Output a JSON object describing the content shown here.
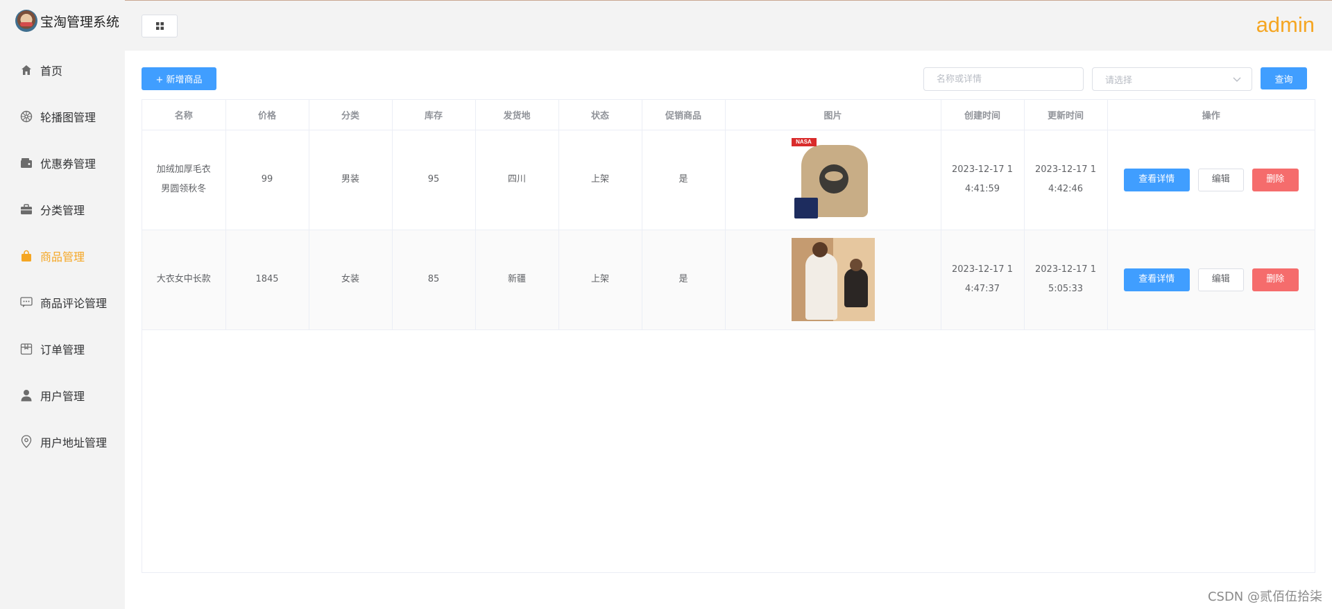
{
  "app": {
    "title": "宝淘管理系统",
    "user": "admin"
  },
  "sidebar": {
    "items": [
      {
        "label": "首页",
        "icon": "home-icon"
      },
      {
        "label": "轮播图管理",
        "icon": "wheel-icon"
      },
      {
        "label": "优惠券管理",
        "icon": "wallet-icon"
      },
      {
        "label": "分类管理",
        "icon": "briefcase-icon"
      },
      {
        "label": "商品管理",
        "icon": "shopping-bag-icon",
        "active": true
      },
      {
        "label": "商品评论管理",
        "icon": "comment-icon"
      },
      {
        "label": "订单管理",
        "icon": "box-icon"
      },
      {
        "label": "用户管理",
        "icon": "user-icon"
      },
      {
        "label": "用户地址管理",
        "icon": "location-icon"
      }
    ]
  },
  "toolbar": {
    "add_label": "+ 新增商品",
    "search_placeholder": "名称或详情",
    "select_placeholder": "请选择",
    "query_label": "查询"
  },
  "table": {
    "headers": [
      "名称",
      "价格",
      "分类",
      "库存",
      "发货地",
      "状态",
      "促销商品",
      "图片",
      "创建时间",
      "更新时间",
      "操作"
    ],
    "rows": [
      {
        "name_line1": "加绒加厚毛衣",
        "name_line2": "男圆领秋冬",
        "price": "99",
        "category": "男装",
        "stock": "95",
        "origin": "四川",
        "status": "上架",
        "promo": "是",
        "image_tag": "NASA",
        "created_line1": "2023-12-17 1",
        "created_line2": "4:41:59",
        "updated_line1": "2023-12-17 1",
        "updated_line2": "4:42:46"
      },
      {
        "name_line1": "大衣女中长款",
        "name_line2": "",
        "price": "1845",
        "category": "女装",
        "stock": "85",
        "origin": "新疆",
        "status": "上架",
        "promo": "是",
        "created_line1": "2023-12-17 1",
        "created_line2": "4:47:37",
        "updated_line1": "2023-12-17 1",
        "updated_line2": "5:05:33"
      }
    ],
    "actions": {
      "view": "查看详情",
      "edit": "编辑",
      "delete": "删除"
    }
  },
  "watermark": "CSDN @贰佰伍拾柒",
  "colors": {
    "primary": "#409eff",
    "danger": "#f56c6c",
    "accent": "#f5a623"
  }
}
